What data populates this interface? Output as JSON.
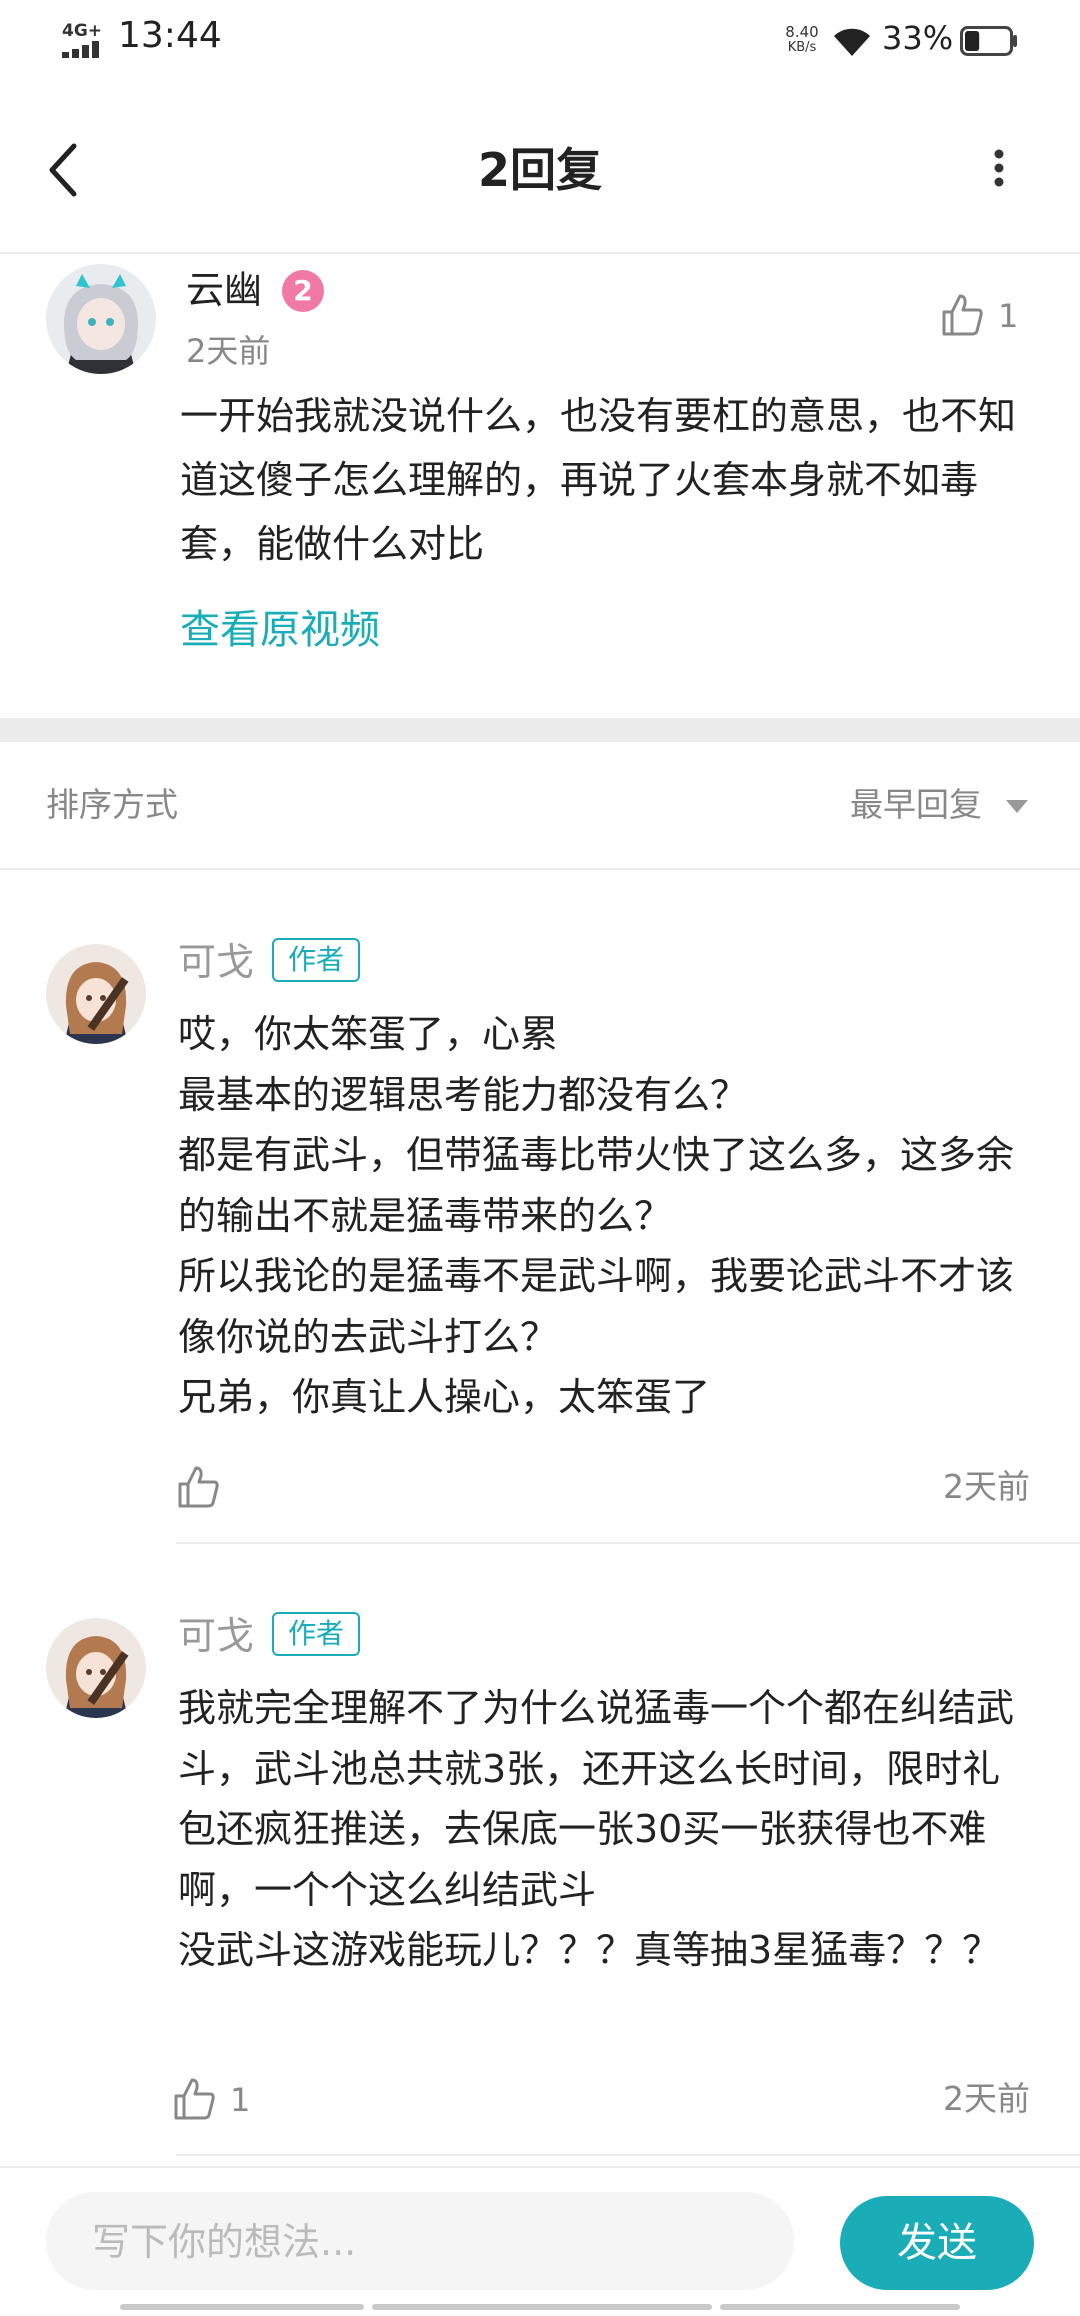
{
  "status_bar": {
    "network": "4G+",
    "time": "13:44",
    "speed_value": "8.40",
    "speed_unit": "KB/s",
    "battery_text": "33%",
    "battery_level": 0.33
  },
  "header": {
    "title": "2回复",
    "back_icon": "chevron-left-icon",
    "more_icon": "more-vertical-icon"
  },
  "main_comment": {
    "username": "云幽",
    "level": "2",
    "time": "2天前",
    "like_count": "1",
    "content": "一开始我就没说什么，也没有要杠的意思，也不知道这傻子怎么理解的，再说了火套本身就不如毒套，能做什么对比",
    "view_video_link": "查看原视频"
  },
  "sort": {
    "label": "排序方式",
    "value": "最早回复"
  },
  "replies": [
    {
      "username": "可戈",
      "tag": "作者",
      "content": "哎，你太笨蛋了，心累\n最基本的逻辑思考能力都没有么？\n都是有武斗，但带猛毒比带火快了这么多，这多余的输出不就是猛毒带来的么？\n所以我论的是猛毒不是武斗啊，我要论武斗不才该像你说的去武斗打么？\n兄弟，你真让人操心，太笨蛋了",
      "like_count": "",
      "time": "2天前"
    },
    {
      "username": "可戈",
      "tag": "作者",
      "content": "我就完全理解不了为什么说猛毒一个个都在纠结武斗，武斗池总共就3张，还开这么长时间，限时礼包还疯狂推送，去保底一张30买一张获得也不难啊，一个个这么纠结武斗\n没武斗这游戏能玩儿？？？真等抽3星猛毒？？？",
      "like_count": "1",
      "time": "2天前"
    }
  ],
  "comment_bar": {
    "placeholder": "写下你的想法...",
    "send_label": "发送"
  },
  "colors": {
    "accent": "#1aadb8",
    "level_badge": "#f07aa4",
    "muted_text": "#888888"
  }
}
